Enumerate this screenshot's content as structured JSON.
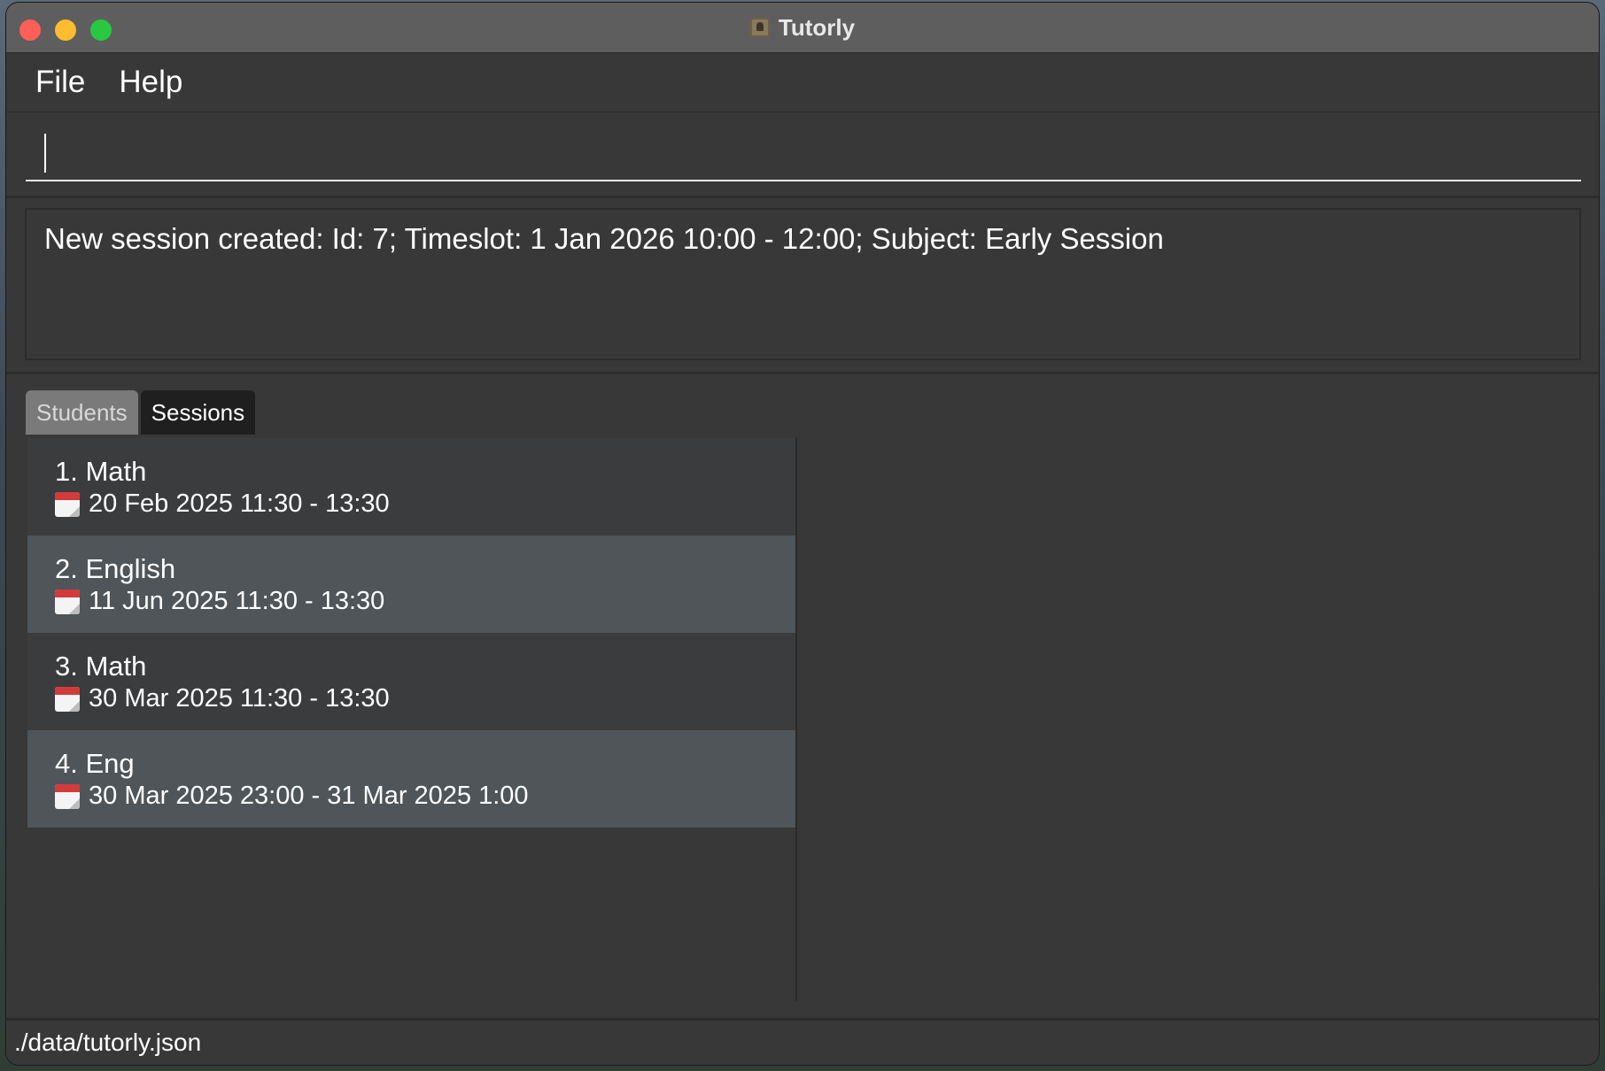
{
  "window": {
    "title": "Tutorly"
  },
  "menu": {
    "file": "File",
    "help": "Help"
  },
  "command": {
    "value": ""
  },
  "result": {
    "message": "New session created: Id: 7; Timeslot: 1 Jan 2026 10:00 - 12:00; Subject: Early Session"
  },
  "tabs": [
    {
      "label": "Students",
      "selected": false
    },
    {
      "label": "Sessions",
      "selected": true
    }
  ],
  "sessions": [
    {
      "title": "1. Math",
      "time": "20 Feb 2025 11:30 - 13:30"
    },
    {
      "title": "2. English",
      "time": "11 Jun 2025 11:30 - 13:30"
    },
    {
      "title": "3. Math",
      "time": "30 Mar 2025 11:30 - 13:30"
    },
    {
      "title": "4. Eng",
      "time": "30 Mar 2025 23:00 - 31 Mar 2025 1:00"
    }
  ],
  "status": {
    "path": "./data/tutorly.json"
  },
  "icons": {
    "app": "app-icon",
    "calendar": "calendar-icon"
  },
  "colors": {
    "titlebar": "#5e5e5e",
    "background": "#383838",
    "close": "#ff5f57",
    "minimize": "#febc2e",
    "maximize": "#28c840",
    "tab_active": "#1f1f1f",
    "tab_inactive": "#7a7a7a",
    "row_alt": "#4f5559"
  }
}
